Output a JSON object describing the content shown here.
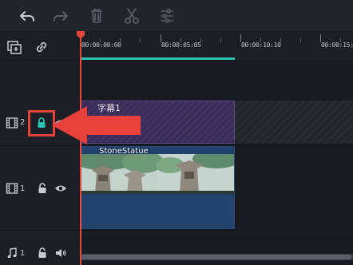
{
  "toolbar": {
    "items": [
      {
        "icon": "undo-icon",
        "enabled": true
      },
      {
        "icon": "redo-icon",
        "enabled": false
      },
      {
        "icon": "delete-icon",
        "enabled": false
      },
      {
        "icon": "cut-icon",
        "enabled": false
      },
      {
        "icon": "adjust-icon",
        "enabled": false
      }
    ]
  },
  "timeline_header": {
    "icons": [
      "add-track-icon",
      "link-icon"
    ]
  },
  "ruler": {
    "timecodes": [
      "00:00:00:00",
      "00:00:05:05",
      "00:00:10:10",
      "00:00:15:1"
    ]
  },
  "tracks": [
    {
      "type": "text",
      "number": "2",
      "locked": true,
      "visible": true
    },
    {
      "type": "video",
      "number": "1",
      "locked": false,
      "visible": true
    },
    {
      "type": "audio",
      "number": "1",
      "locked": false,
      "muted": false
    }
  ],
  "clips": {
    "text_clip_label": "字幕1",
    "video_clip_label": "StoneStatue"
  },
  "colors": {
    "accent": "#2fc4b2",
    "playhead": "#e8473b",
    "highlight": "#e8413c",
    "text_clip": "#3a2d55",
    "audio_clip": "#24446f",
    "lock_active": "#2fc4b2"
  }
}
